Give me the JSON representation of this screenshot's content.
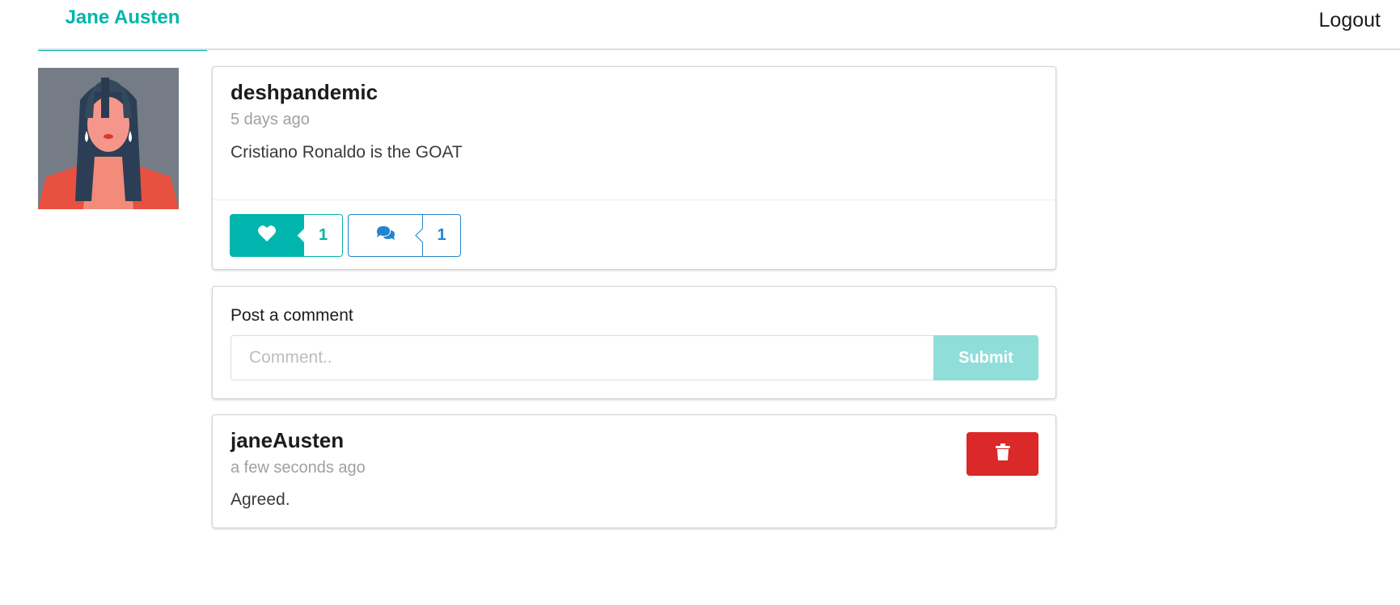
{
  "menu": {
    "user_name": "Jane Austen",
    "logout_label": "Logout"
  },
  "avatar": {
    "alt": "Jane Austen avatar"
  },
  "post": {
    "author": "deshpandemic",
    "time": "5 days ago",
    "body": "Cristiano Ronaldo is the GOAT",
    "like_count": "1",
    "comment_count": "1",
    "like_icon": "heart-icon",
    "comment_icon": "comments-icon"
  },
  "comment_form": {
    "label": "Post a comment",
    "placeholder": "Comment..",
    "value": "",
    "submit_label": "Submit"
  },
  "comments": [
    {
      "author": "janeAusten",
      "time": "a few seconds ago",
      "body": "Agreed.",
      "delete_icon": "trash-icon"
    }
  ],
  "colors": {
    "teal": "#00b5ad",
    "blue": "#2185d0",
    "red": "#db2828",
    "submit_disabled": "#8fdeda"
  }
}
